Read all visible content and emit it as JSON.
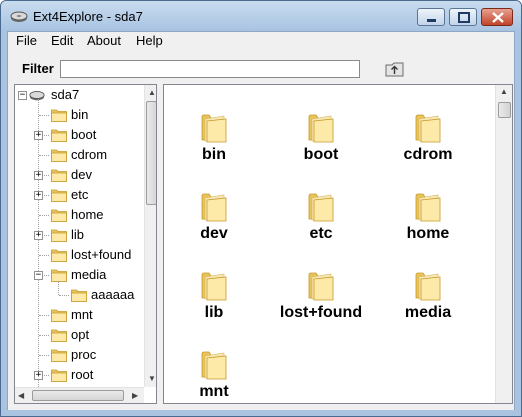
{
  "window": {
    "title": "Ext4Explore - sda7",
    "icon": "drive-icon"
  },
  "menu": [
    "File",
    "Edit",
    "About",
    "Help"
  ],
  "filter": {
    "label": "Filter",
    "value": "",
    "up_icon": "folder-up-icon"
  },
  "tree": {
    "root": "sda7",
    "items": [
      {
        "label": "bin",
        "expandable": false
      },
      {
        "label": "boot",
        "expandable": true,
        "expander": "+"
      },
      {
        "label": "cdrom",
        "expandable": false
      },
      {
        "label": "dev",
        "expandable": true,
        "expander": "+"
      },
      {
        "label": "etc",
        "expandable": true,
        "expander": "+"
      },
      {
        "label": "home",
        "expandable": false
      },
      {
        "label": "lib",
        "expandable": true,
        "expander": "+"
      },
      {
        "label": "lost+found",
        "expandable": false
      },
      {
        "label": "media",
        "expandable": true,
        "expander": "−"
      },
      {
        "label": "aaaaaa",
        "expandable": false,
        "child": true
      },
      {
        "label": "mnt",
        "expandable": false
      },
      {
        "label": "opt",
        "expandable": false
      },
      {
        "label": "proc",
        "expandable": false
      },
      {
        "label": "root",
        "expandable": true,
        "expander": "+"
      }
    ]
  },
  "files": [
    "bin",
    "boot",
    "cdrom",
    "dev",
    "etc",
    "home",
    "lib",
    "lost+found",
    "media",
    "mnt"
  ],
  "colors": {
    "folder_light": "#fde9a8",
    "folder_dark": "#e8c35a",
    "folder_edge": "#c79a2a",
    "title_bg": "#b6cde8"
  }
}
